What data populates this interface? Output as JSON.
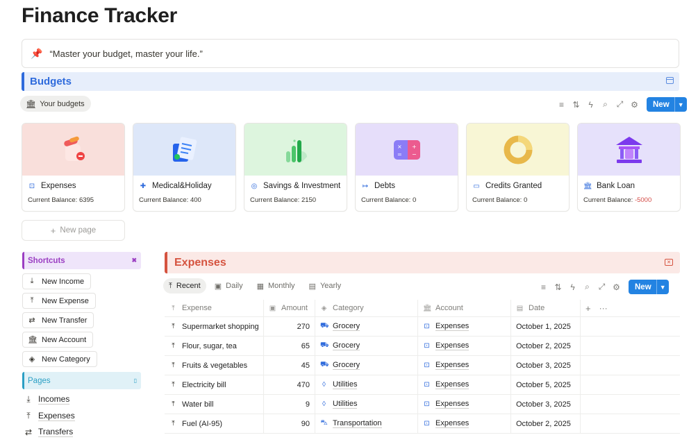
{
  "page": {
    "title": "Finance Tracker"
  },
  "quote": {
    "icon": "pushpin-icon",
    "text": "“Master your budget, master your life.”"
  },
  "budgets": {
    "header": "Budgets",
    "view_chip": "Your budgets",
    "new_label": "New",
    "cards": [
      {
        "name": "Expenses",
        "balance_label": "Current Balance:",
        "balance": "6395",
        "cover_color": "#f9dfdb",
        "icon": "expenses-icon"
      },
      {
        "name": "Medical&Holiday",
        "balance_label": "Current Balance:",
        "balance": "400",
        "cover_color": "#dde7f9",
        "icon": "medical-icon"
      },
      {
        "name": "Savings & Investment",
        "balance_label": "Current Balance:",
        "balance": "2150",
        "cover_color": "#ddf5de",
        "icon": "savings-icon"
      },
      {
        "name": "Debts",
        "balance_label": "Current Balance:",
        "balance": "0",
        "cover_color": "#e6defa",
        "icon": "debts-icon"
      },
      {
        "name": "Credits Granted",
        "balance_label": "Current Balance:",
        "balance": "0",
        "cover_color": "#f8f6d5",
        "icon": "credits-icon"
      },
      {
        "name": "Bank Loan",
        "balance_label": "Current Balance:",
        "balance": "-5000",
        "cover_color": "#e6e1fb",
        "icon": "bank-icon"
      }
    ],
    "new_page": "New page"
  },
  "sidebar": {
    "shortcuts_header": "Shortcuts",
    "shortcuts": [
      "New Income",
      "New Expense",
      "New Transfer",
      "New Account",
      "New Category"
    ],
    "pages_header": "Pages",
    "pages": [
      "Incomes",
      "Expenses",
      "Transfers"
    ]
  },
  "expenses": {
    "header": "Expenses",
    "tabs": [
      "Recent",
      "Daily",
      "Monthly",
      "Yearly"
    ],
    "new_label": "New",
    "columns": [
      "Expense",
      "Amount",
      "Category",
      "Account",
      "Date"
    ],
    "rows": [
      {
        "expense": "Supermarket shopping",
        "amount": "270",
        "category": "Grocery",
        "account": "Expenses",
        "date": "October 1, 2025"
      },
      {
        "expense": "Flour, sugar, tea",
        "amount": "65",
        "category": "Grocery",
        "account": "Expenses",
        "date": "October 2, 2025"
      },
      {
        "expense": "Fruits & vegetables",
        "amount": "45",
        "category": "Grocery",
        "account": "Expenses",
        "date": "October 3, 2025"
      },
      {
        "expense": "Electricity bill",
        "amount": "470",
        "category": "Utilities",
        "account": "Expenses",
        "date": "October 5, 2025"
      },
      {
        "expense": "Water bill",
        "amount": "9",
        "category": "Utilities",
        "account": "Expenses",
        "date": "October 3, 2025"
      },
      {
        "expense": "Fuel (AI-95)",
        "amount": "90",
        "category": "Transportation",
        "account": "Expenses",
        "date": "October 2, 2025"
      }
    ]
  },
  "colors": {
    "accent": "#2383e2",
    "budgets": "#2f6bdc",
    "expenses": "#d5533f",
    "negative": "#d44c47"
  }
}
